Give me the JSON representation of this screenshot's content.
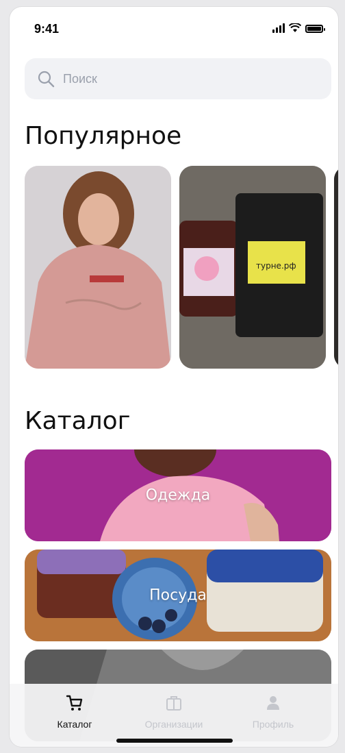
{
  "status_bar": {
    "time": "9:41"
  },
  "search": {
    "placeholder": "Поиск"
  },
  "popular": {
    "title": "Популярное",
    "cards": [
      {
        "image": "pink-hoodie-photo"
      },
      {
        "image": "jam-and-coffee-photo"
      },
      {
        "image": "partial-card-photo"
      }
    ]
  },
  "catalog": {
    "title": "Каталог",
    "categories": [
      {
        "label": "Одежда"
      },
      {
        "label": "Посуда"
      },
      {
        "label": ""
      }
    ]
  },
  "tabbar": {
    "items": [
      {
        "label": "Каталог",
        "icon": "cart-icon",
        "active": true
      },
      {
        "label": "Организации",
        "icon": "briefcase-icon",
        "active": false
      },
      {
        "label": "Профиль",
        "icon": "person-icon",
        "active": false
      }
    ]
  },
  "colors": {
    "accent": "#111111",
    "inactive": "#c4c6cc",
    "search_bg": "#f1f2f5"
  }
}
